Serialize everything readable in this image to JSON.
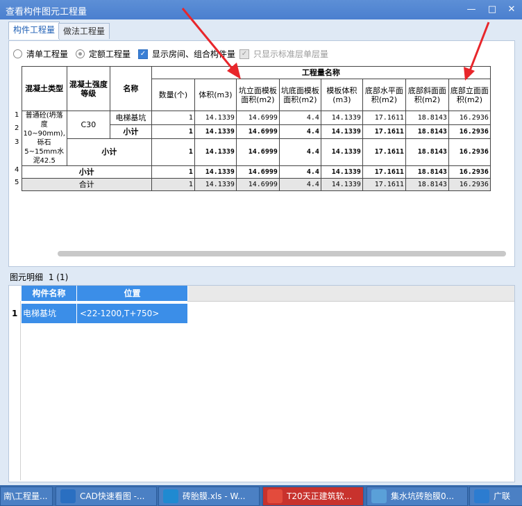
{
  "window": {
    "title": "查看构件图元工程量"
  },
  "tabs": [
    {
      "label": "构件工程量"
    },
    {
      "label": "做法工程量"
    }
  ],
  "options": {
    "qd_label": "清单工程量",
    "de_label": "定额工程量",
    "show_rooms_label": "显示房间、组合构件量",
    "std_floor_label": "只显示标准层单层量"
  },
  "table": {
    "headers": {
      "type": "混凝土类型",
      "grade": "混凝土强度等级",
      "name": "名称",
      "group": "工程量名称",
      "cols": [
        "数量(个)",
        "体积(m3)",
        "坑立面模板面积(m2)",
        "坑底面模板面积(m2)",
        "模板体积(m3)",
        "底部水平面积(m2)",
        "底部斜面面积(m2)",
        "底部立面面积(m2)"
      ]
    },
    "type_value": "普通砼(坍落度10~90mm),砾石5~15mm水泥42.5",
    "grade_value": "C30",
    "rows": [
      {
        "num": "1",
        "name": "电梯基坑",
        "values": [
          "1",
          "14.1339",
          "14.6999",
          "4.4",
          "14.1339",
          "17.1611",
          "18.8143",
          "16.2936"
        ]
      },
      {
        "num": "2",
        "name": "小计",
        "values": [
          "1",
          "14.1339",
          "14.6999",
          "4.4",
          "14.1339",
          "17.1611",
          "18.8143",
          "16.2936"
        ]
      },
      {
        "num": "3",
        "name": "小计",
        "values": [
          "1",
          "14.1339",
          "14.6999",
          "4.4",
          "14.1339",
          "17.1611",
          "18.8143",
          "16.2936"
        ]
      },
      {
        "num": "4",
        "name": "小计",
        "values": [
          "1",
          "14.1339",
          "14.6999",
          "4.4",
          "14.1339",
          "17.1611",
          "18.8143",
          "16.2936"
        ]
      },
      {
        "num": "5",
        "name": "合计",
        "values": [
          "1",
          "14.1339",
          "14.6999",
          "4.4",
          "14.1339",
          "17.1611",
          "18.8143",
          "16.2936"
        ]
      }
    ]
  },
  "detail": {
    "label": "图元明细",
    "count": "1 (1)",
    "headers": [
      "构件名称",
      "位置"
    ],
    "row": {
      "num": "1",
      "name": "电梯基坑",
      "position": "<22-1200,T+750>"
    }
  },
  "taskbar": [
    {
      "label": "南\\工程量..."
    },
    {
      "label": "CAD快速看图 -..."
    },
    {
      "label": "砖胎膜.xls - W..."
    },
    {
      "label": "T20天正建筑软..."
    },
    {
      "label": "集水坑砖胎膜0..."
    },
    {
      "label": "广联"
    }
  ],
  "colors": {
    "accent": "#3b8ee8",
    "titlebar": "#4a7fcf",
    "arrow": "#e8262b"
  }
}
